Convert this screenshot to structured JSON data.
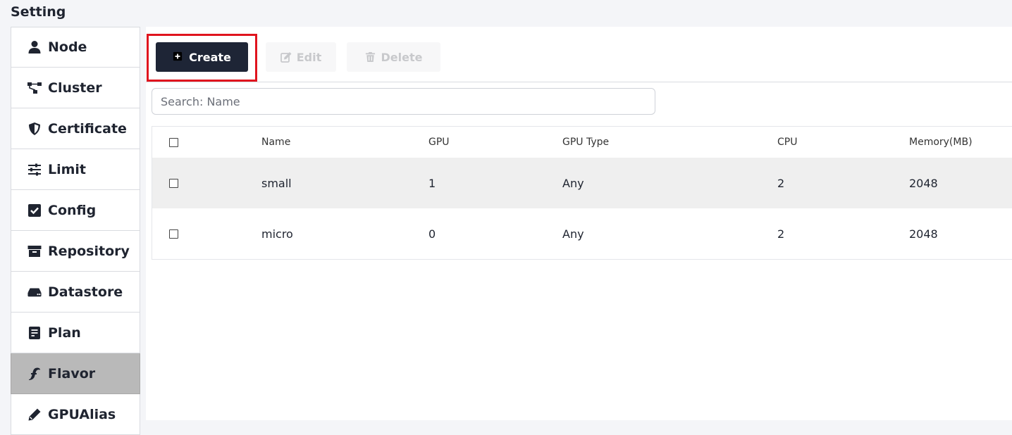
{
  "page": {
    "title": "Setting"
  },
  "sidebar": {
    "items": [
      {
        "label": "Node",
        "icon": "user-icon",
        "active": false
      },
      {
        "label": "Cluster",
        "icon": "sitemap-icon",
        "active": false
      },
      {
        "label": "Certificate",
        "icon": "shield-icon",
        "active": false
      },
      {
        "label": "Limit",
        "icon": "sliders-icon",
        "active": false
      },
      {
        "label": "Config",
        "icon": "checkbox-icon",
        "active": false
      },
      {
        "label": "Repository",
        "icon": "archive-icon",
        "active": false
      },
      {
        "label": "Datastore",
        "icon": "hdd-icon",
        "active": false
      },
      {
        "label": "Plan",
        "icon": "document-icon",
        "active": false
      },
      {
        "label": "Flavor",
        "icon": "flavor-icon",
        "active": true
      },
      {
        "label": "GPUAlias",
        "icon": "pencil-icon",
        "active": false
      }
    ]
  },
  "toolbar": {
    "create_label": "Create",
    "edit_label": "Edit",
    "delete_label": "Delete"
  },
  "search": {
    "placeholder": "Search: Name",
    "value": ""
  },
  "table": {
    "columns": [
      "Name",
      "GPU",
      "GPU Type",
      "CPU",
      "Memory(MB)"
    ],
    "rows": [
      {
        "name": "small",
        "gpu": "1",
        "gpu_type": "Any",
        "cpu": "2",
        "memory": "2048"
      },
      {
        "name": "micro",
        "gpu": "0",
        "gpu_type": "Any",
        "cpu": "2",
        "memory": "2048"
      }
    ]
  },
  "colors": {
    "primary_button": "#1e2536",
    "highlight": "#e0141e",
    "active_sidebar": "#b9b9b9"
  }
}
